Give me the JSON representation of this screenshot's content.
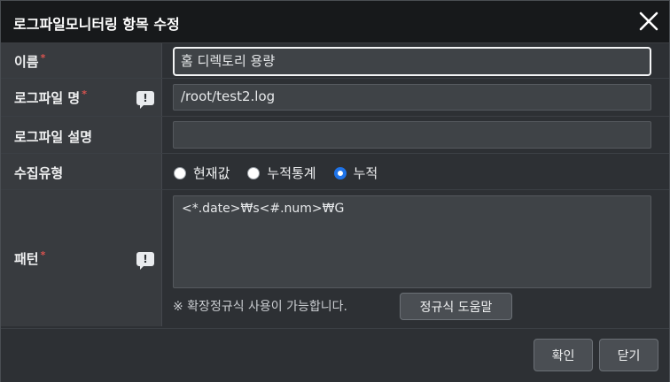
{
  "dialog": {
    "title": "로그파일모니터링 항목 수정",
    "close_icon": "close-icon"
  },
  "fields": {
    "name": {
      "label": "이름",
      "value": "홈 디렉토리 용량",
      "required": "*"
    },
    "logfile": {
      "label": "로그파일 명",
      "value": "/root/test2.log",
      "required": "*"
    },
    "description": {
      "label": "로그파일 설명",
      "value": ""
    },
    "collect_type": {
      "label": "수집유형",
      "options": [
        "현재값",
        "누적통계",
        "누적"
      ],
      "selected": "누적"
    },
    "pattern": {
      "label": "패턴",
      "required": "*",
      "value": "<*.date>₩s<#.num>₩G",
      "hint": "※ 확장정규식 사용이 가능합니다.",
      "help_button": "정규식 도움말"
    }
  },
  "info_glyph": "!",
  "footer": {
    "confirm_label": "확인",
    "close_label": "닫기"
  },
  "colors": {
    "accent": "#1e73e8",
    "required": "#d9534f"
  }
}
